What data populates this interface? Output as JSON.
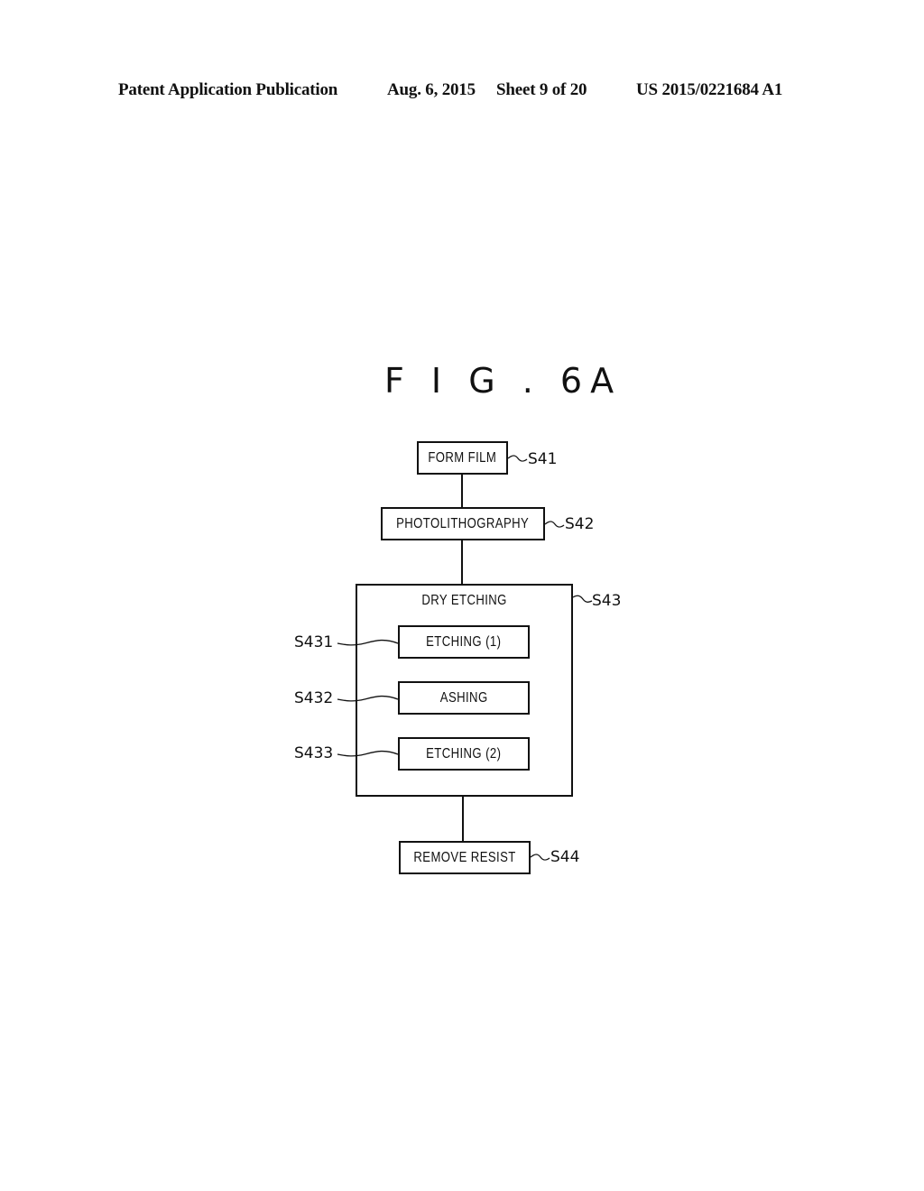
{
  "header": {
    "publication": "Patent Application Publication",
    "date": "Aug. 6, 2015",
    "sheet": "Sheet 9 of 20",
    "number": "US 2015/0221684 A1"
  },
  "figure": {
    "title": "F I G . 6A",
    "steps": [
      {
        "id": "S41",
        "label": "FORM FILM"
      },
      {
        "id": "S42",
        "label": "PHOTOLITHOGRAPHY"
      },
      {
        "id": "S43",
        "label": "DRY ETCHING",
        "substeps": [
          {
            "id": "S431",
            "label": "ETCHING (1)"
          },
          {
            "id": "S432",
            "label": "ASHING"
          },
          {
            "id": "S433",
            "label": "ETCHING (2)"
          }
        ]
      },
      {
        "id": "S44",
        "label": "REMOVE RESIST"
      }
    ]
  }
}
